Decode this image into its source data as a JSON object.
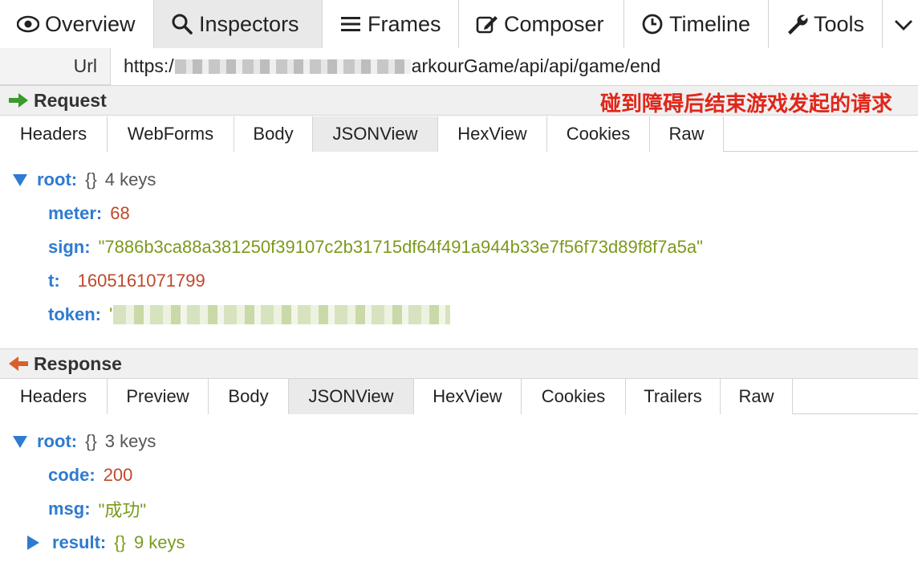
{
  "top_tabs": [
    {
      "label": "Overview",
      "icon": "eye-icon"
    },
    {
      "label": "Inspectors",
      "icon": "search-icon"
    },
    {
      "label": "Frames",
      "icon": "list-icon"
    },
    {
      "label": "Composer",
      "icon": "edit-icon"
    },
    {
      "label": "Timeline",
      "icon": "clock-icon"
    },
    {
      "label": "Tools",
      "icon": "wrench-icon"
    }
  ],
  "url": {
    "label": "Url",
    "prefix": "https:/",
    "suffix": "arkourGame/api/api/game/end"
  },
  "request": {
    "title": "Request",
    "annotation": "碰到障碍后结束游戏发起的请求",
    "tabs": [
      "Headers",
      "WebForms",
      "Body",
      "JSONView",
      "HexView",
      "Cookies",
      "Raw"
    ],
    "active_tab": "JSONView",
    "root": {
      "key": "root:",
      "brace": "{}",
      "count": "4 keys"
    },
    "fields": [
      {
        "key": "meter:",
        "value": "68",
        "kind": "num"
      },
      {
        "key": "sign:",
        "value": "\"7886b3ca88a381250f39107c2b31715df64f491a944b33e7f56f73d89f8f7a5a\"",
        "kind": "str"
      },
      {
        "key": "t:",
        "value": "1605161071799",
        "kind": "num"
      },
      {
        "key": "token:",
        "value": "'",
        "kind": "str"
      }
    ]
  },
  "response": {
    "title": "Response",
    "tabs": [
      "Headers",
      "Preview",
      "Body",
      "JSONView",
      "HexView",
      "Cookies",
      "Trailers",
      "Raw"
    ],
    "active_tab": "JSONView",
    "root": {
      "key": "root:",
      "brace": "{}",
      "count": "3 keys"
    },
    "fields": [
      {
        "key": "code:",
        "value": "200",
        "kind": "num"
      },
      {
        "key": "msg:",
        "value": "\"成功\"",
        "kind": "str"
      }
    ],
    "result": {
      "key": "result:",
      "brace": "{}",
      "count": "9 keys"
    }
  },
  "colors": {
    "key_blue": "#2e7bcf",
    "number_orange": "#c0482b",
    "string_green": "#7a9a1c",
    "annotation_red": "#e0261a",
    "request_arrow": "#3a9a2a",
    "response_arrow": "#d9602a"
  }
}
